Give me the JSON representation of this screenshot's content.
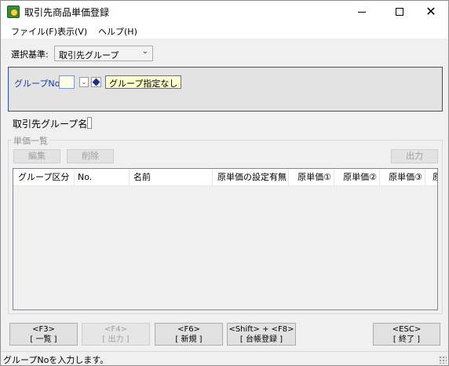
{
  "window": {
    "title": "取引先商品単価登録",
    "minimize": "─",
    "close": "✕"
  },
  "menu": {
    "file": "ファイル(F)",
    "view": "表示(V)",
    "help": "ヘルプ(H)"
  },
  "selection": {
    "label": "選択基準:",
    "value": "取引先グループ",
    "arrow": "⌄"
  },
  "group": {
    "label": "グループNo.",
    "value": "",
    "combo_arrow": "⌄",
    "tip": "グループ指定なし"
  },
  "group_name": {
    "label": "取引先グループ名:",
    "value": ""
  },
  "price_list": {
    "legend": "単価一覧",
    "edit_label": "編集",
    "delete_label": "削除",
    "output_label": "出力",
    "columns": [
      "グループ区分",
      "No.",
      "名前",
      "原単価の設定有無",
      "原単価①",
      "原単価②",
      "原単価③",
      "原"
    ],
    "rows": []
  },
  "function_keys": [
    {
      "key": "<F3>",
      "action": "[ 一覧 ]",
      "enabled": true
    },
    {
      "key": "<F4>",
      "action": "[ 出力 ]",
      "enabled": false
    },
    {
      "key": "<F6>",
      "action": "[ 新規 ]",
      "enabled": true
    },
    {
      "key": "<Shift> + <F8>",
      "action": "[ 台帳登録 ]",
      "enabled": true
    },
    {
      "key": "<ESC>",
      "action": "[ 終了 ]",
      "enabled": true
    }
  ],
  "status": {
    "text": "グループNoを入力します。"
  },
  "colors": {
    "panel_border": "#2b4bbf",
    "label_blue": "#1b3aa8",
    "tip_bg": "#ffffcc"
  }
}
